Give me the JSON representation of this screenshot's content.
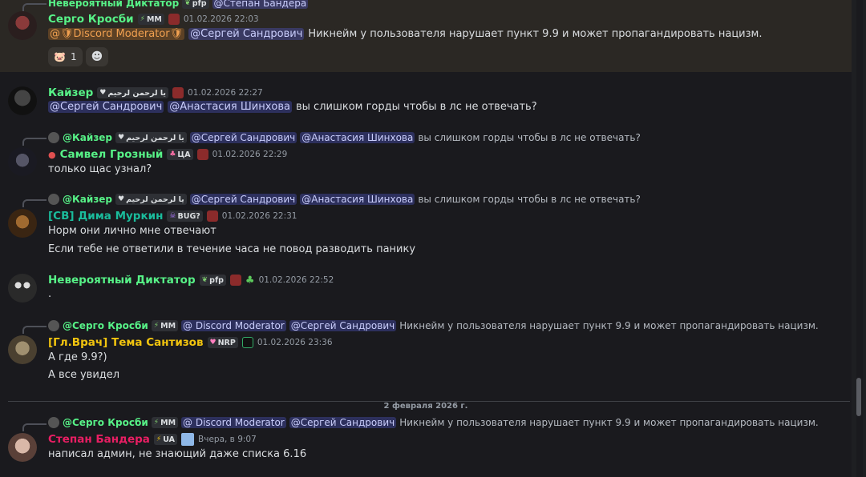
{
  "messages": [
    {
      "id": "m1",
      "reply": {
        "author": "Невероятный Диктатор",
        "badge": "pfp",
        "text": "@Степан Бандера"
      },
      "author": "Серго Кросби",
      "author_color": "#57f287",
      "badge": "MM",
      "timestamp": "01.02.2026 22:03",
      "role_tag": "Discord Moderator",
      "mention": "@Сергей Сандрович",
      "text": "Никнейм у пользователя нарушает пункт 9.9 и может пропагандировать нацизм.",
      "reaction_count": "1"
    },
    {
      "id": "m2",
      "author": "Кайзер",
      "author_color": "#57f287",
      "badge": "ﯾﺎ ﻟﺮﺣﻤﻦ ﻟﺮﺣﻴﻢ",
      "timestamp": "01.02.2026 22:27",
      "mention1": "@Сергей Сандрович",
      "mention2": "@Анастасия Шинхова",
      "text": "вы слишком горды чтобы в лс не отвечать?"
    },
    {
      "id": "m3",
      "reply": {
        "author": "@Кайзер",
        "badge": "ﯾﺎ ﻟﺮﺣﻤﻦ ﻟﺮﺣﻴﻢ",
        "mention1": "@Сергей Сандрович",
        "mention2": "@Анастасия Шинхова",
        "text": "вы слишком горды чтобы в лс не отвечать?"
      },
      "author": "Самвел Грозный",
      "author_color": "#57f287",
      "badge": "ЦА",
      "timestamp": "01.02.2026 22:29",
      "text": "только щас узнал?"
    },
    {
      "id": "m4",
      "reply": {
        "author": "@Кайзер",
        "badge": "ﯾﺎ ﻟﺮﺣﻤﻦ ﻟﺮﺣﻴﻢ",
        "mention1": "@Сергей Сандрович",
        "mention2": "@Анастасия Шинхова",
        "text": "вы слишком горды чтобы в лс не отвечать?"
      },
      "author": "[CB] Дима Муркин",
      "author_color": "#1abc9c",
      "badge": "BUG?",
      "timestamp": "01.02.2026 22:31",
      "text1": "Норм они лично мне отвечают",
      "text2": "Если тебе не ответили в течение часа не повод разводить панику"
    },
    {
      "id": "m5",
      "author": "Невероятный Диктатор",
      "author_color": "#57f287",
      "badge": "pfp",
      "timestamp": "01.02.2026 22:52",
      "text": "."
    },
    {
      "id": "m6",
      "reply": {
        "author": "@Серго Кросби",
        "badge": "MM",
        "role_tag": "@ Discord Moderator",
        "mention": "@Сергей Сандрович",
        "text": "Никнейм у пользователя нарушает пункт 9.9 и может пропагандировать нацизм."
      },
      "author": "[Гл.Врач] Тема Сантизов",
      "author_color": "#f1c40f",
      "badge": "NRP",
      "timestamp": "01.02.2026 23:36",
      "text1": "А где 9.9?)",
      "text2": "А все увидел"
    },
    {
      "id": "m7",
      "reply": {
        "author": "@Серго Кросби",
        "badge": "MM",
        "role_tag": "@ Discord Moderator",
        "mention": "@Сергей Сандрович",
        "text": "Никнейм у пользователя нарушает пункт 9.9 и может пропагандировать нацизм."
      },
      "author": "Степан Бандера",
      "author_color": "#e91e63",
      "badge": "UA",
      "timestamp": "Вчера, в 9:07",
      "text": "написал админ, не знающий даже списка 6.16"
    }
  ],
  "divider": "2 февраля 2026 г."
}
